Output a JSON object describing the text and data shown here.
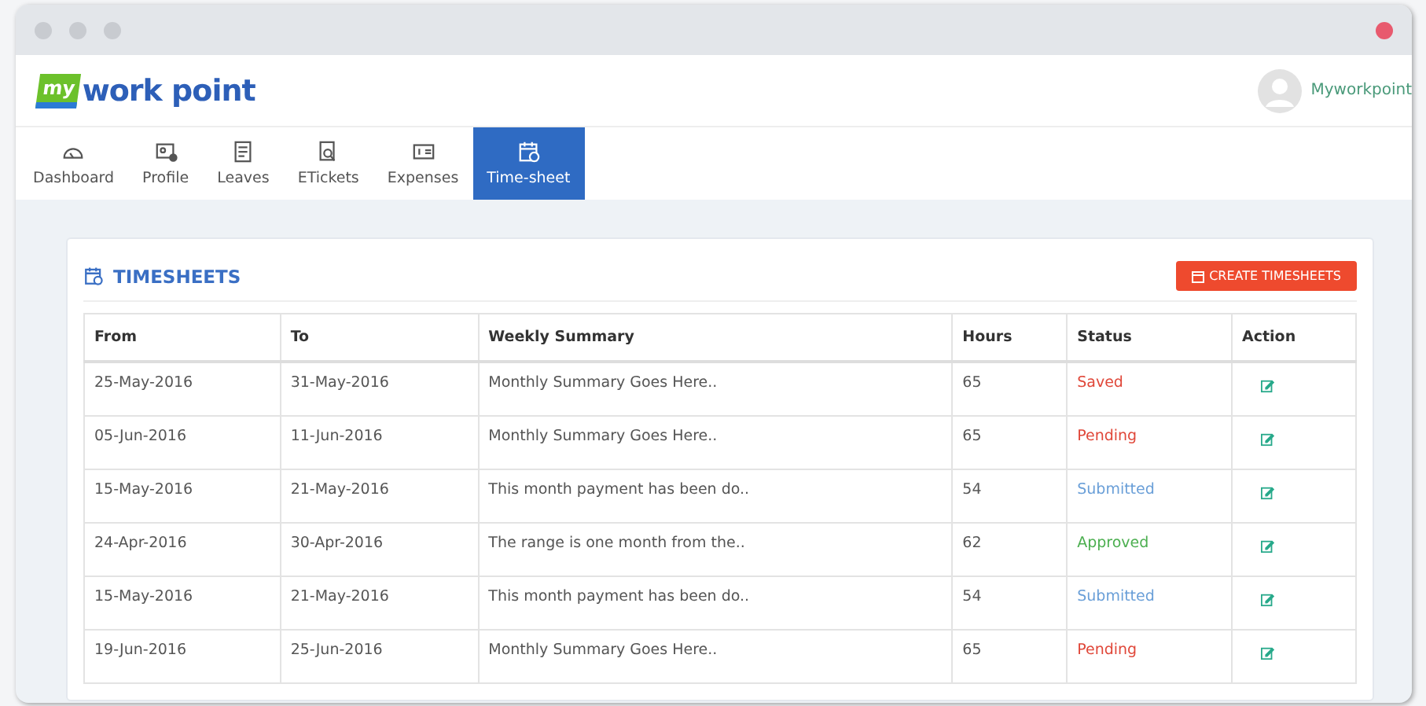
{
  "logo": {
    "badge": "my",
    "text": "work point"
  },
  "user": {
    "name": "Myworkpoint"
  },
  "nav": [
    {
      "label": "Dashboard",
      "selected": false
    },
    {
      "label": "Profile",
      "selected": false
    },
    {
      "label": "Leaves",
      "selected": false
    },
    {
      "label": "ETickets",
      "selected": false
    },
    {
      "label": "Expenses",
      "selected": false
    },
    {
      "label": "Time-sheet",
      "selected": true
    }
  ],
  "panel": {
    "title": "TIMESHEETS",
    "create_button": "CREATE TIMESHEETS"
  },
  "table": {
    "columns": [
      "From",
      "To",
      "Weekly Summary",
      "Hours",
      "Status",
      "Action"
    ],
    "rows": [
      {
        "from": "25-May-2016",
        "to": "31-May-2016",
        "summary": "Monthly Summary Goes Here..",
        "hours": "65",
        "status": "Saved",
        "color": "#e0483a"
      },
      {
        "from": "05-Jun-2016",
        "to": "11-Jun-2016",
        "summary": "Monthly Summary Goes Here..",
        "hours": "65",
        "status": "Pending",
        "color": "#e0483a"
      },
      {
        "from": "15-May-2016",
        "to": "21-May-2016",
        "summary": "This month payment has been do..",
        "hours": "54",
        "status": "Submitted",
        "color": "#6a9fd8"
      },
      {
        "from": "24-Apr-2016",
        "to": "30-Apr-2016",
        "summary": "The range is one month from the..",
        "hours": "62",
        "status": "Approved",
        "color": "#4caf50"
      },
      {
        "from": "15-May-2016",
        "to": "21-May-2016",
        "summary": "This month payment has been do..",
        "hours": "54",
        "status": "Submitted",
        "color": "#6a9fd8"
      },
      {
        "from": "19-Jun-2016",
        "to": "25-Jun-2016",
        "summary": "Monthly Summary Goes Here..",
        "hours": "65",
        "status": "Pending",
        "color": "#e0483a"
      }
    ]
  }
}
